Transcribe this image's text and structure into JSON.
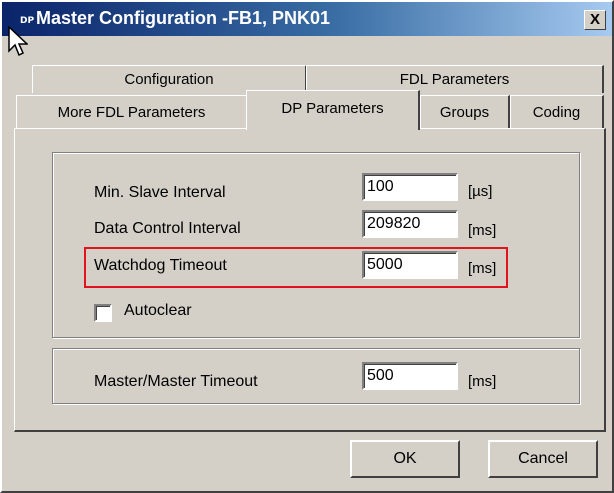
{
  "window": {
    "title": "Master Configuration  -FB1, PNK01",
    "icon_label": "DP",
    "close_label": "X"
  },
  "tabs": {
    "row_back": [
      {
        "label": "Configuration"
      },
      {
        "label": "FDL Parameters"
      }
    ],
    "row_front": [
      {
        "label": "More FDL Parameters"
      },
      {
        "label": "DP Parameters",
        "active": true
      },
      {
        "label": "Groups"
      },
      {
        "label": "Coding"
      }
    ]
  },
  "dp_parameters": {
    "min_slave_interval": {
      "label": "Min. Slave Interval",
      "value": "100",
      "unit": "[µs]"
    },
    "data_control_interval": {
      "label": "Data Control Interval",
      "value": "209820",
      "unit": "[ms]"
    },
    "watchdog_timeout": {
      "label": "Watchdog Timeout",
      "value": "5000",
      "unit": "[ms]"
    },
    "autoclear": {
      "label": "Autoclear",
      "checked": false
    },
    "master_master_timeout": {
      "label": "Master/Master Timeout",
      "value": "500",
      "unit": "[ms]"
    }
  },
  "buttons": {
    "ok": "OK",
    "cancel": "Cancel"
  },
  "colors": {
    "highlight": "#e0141e",
    "title_start": "#0a246a",
    "title_end": "#a6caf0",
    "face": "#d4d0c8"
  },
  "icons": {
    "app": "dp-app-icon",
    "close": "close-icon",
    "cursor": "mouse-pointer-icon"
  }
}
